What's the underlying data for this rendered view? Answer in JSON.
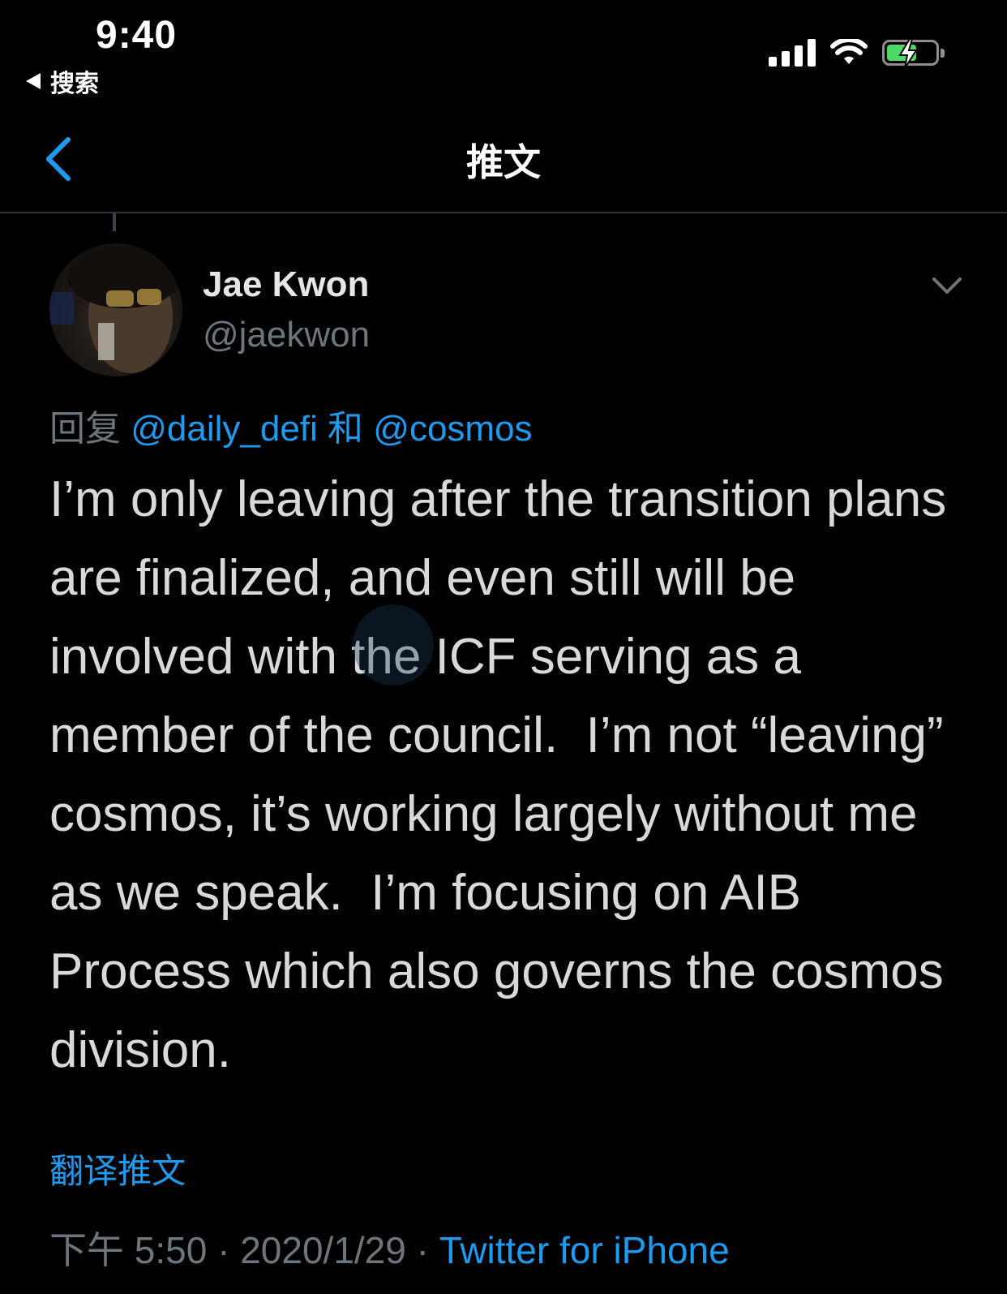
{
  "status_bar": {
    "time": "9:40",
    "back_app_label": "搜索",
    "icons": [
      "cellular-signal-icon",
      "wifi-icon",
      "battery-charging-icon"
    ]
  },
  "nav": {
    "title": "推文",
    "back_icon": "chevron-left-icon"
  },
  "tweet": {
    "display_name": "Jae Kwon",
    "handle": "@jaekwon",
    "reply_prefix": "回复",
    "reply_mention_1": "@daily_defi",
    "reply_conjunction": "和",
    "reply_mention_2": "@cosmos",
    "text": "I’m only leaving after the transition plans are finalized, and even still will be involved with the ICF serving as a member of the council.  I’m not “leaving” cosmos, it’s working largely without me as we speak.  I’m focusing on AIB Process which also governs the cosmos division.",
    "translate_label": "翻译推文",
    "time": "下午 5:50",
    "separator": "·",
    "date": "2020/1/29",
    "source": "Twitter for iPhone"
  },
  "colors": {
    "background": "#000000",
    "accent": "#1d9bf0",
    "secondary_text": "#6e767d",
    "primary_text": "#d9d9d9"
  }
}
